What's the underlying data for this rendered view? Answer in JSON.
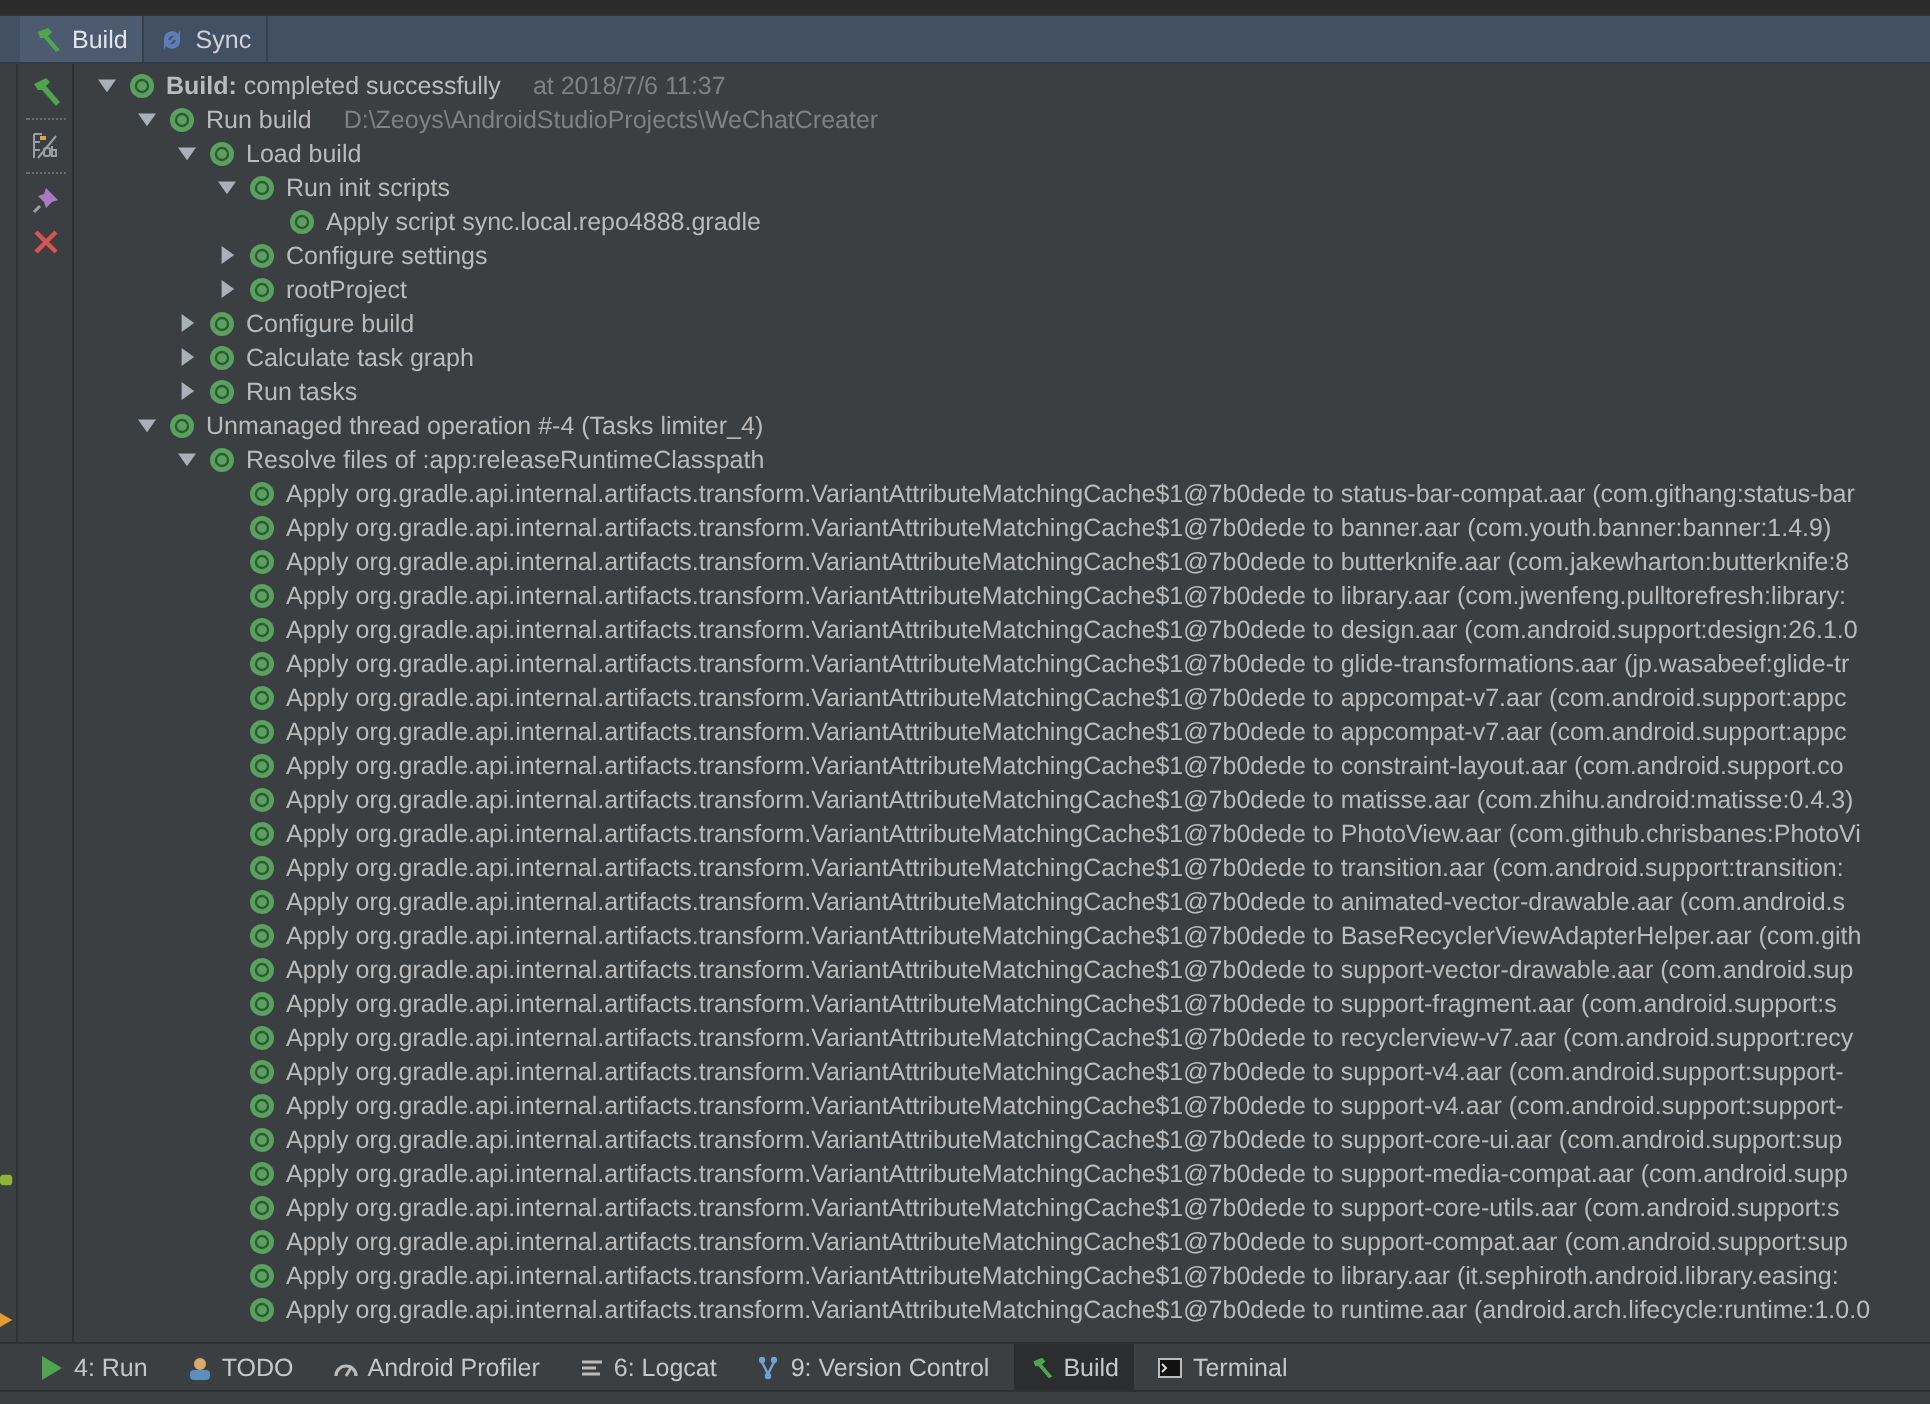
{
  "tabs": [
    {
      "label": "Build",
      "selected": true
    },
    {
      "label": "Sync",
      "selected": false
    }
  ],
  "tree": [
    {
      "label": "**Build:** completed successfully",
      "detail": "at 2018/7/6 11:37",
      "expanded": true,
      "children": [
        {
          "label": "Run build",
          "detail": "D:\\Zeoys\\AndroidStudioProjects\\WeChatCreater",
          "expanded": true,
          "children": [
            {
              "label": "Load build",
              "expanded": true,
              "children": [
                {
                  "label": "Run init scripts",
                  "expanded": true,
                  "children": [
                    {
                      "label": "Apply script sync.local.repo4888.gradle"
                    }
                  ]
                },
                {
                  "label": "Configure settings",
                  "expanded": false
                },
                {
                  "label": "rootProject",
                  "expanded": false
                }
              ]
            },
            {
              "label": "Configure build",
              "expanded": false
            },
            {
              "label": "Calculate task graph",
              "expanded": false
            },
            {
              "label": "Run tasks",
              "expanded": false
            }
          ]
        },
        {
          "label": "Unmanaged thread operation #-4 (Tasks limiter_4)",
          "expanded": true,
          "children": [
            {
              "label": "Resolve files of :app:releaseRuntimeClasspath",
              "expanded": true,
              "children": [
                {
                  "label": "Apply org.gradle.api.internal.artifacts.transform.VariantAttributeMatchingCache$1@7b0dede to status-bar-compat.aar (com.githang:status-bar"
                },
                {
                  "label": "Apply org.gradle.api.internal.artifacts.transform.VariantAttributeMatchingCache$1@7b0dede to banner.aar (com.youth.banner:banner:1.4.9)"
                },
                {
                  "label": "Apply org.gradle.api.internal.artifacts.transform.VariantAttributeMatchingCache$1@7b0dede to butterknife.aar (com.jakewharton:butterknife:8"
                },
                {
                  "label": "Apply org.gradle.api.internal.artifacts.transform.VariantAttributeMatchingCache$1@7b0dede to library.aar (com.jwenfeng.pulltorefresh:library:"
                },
                {
                  "label": "Apply org.gradle.api.internal.artifacts.transform.VariantAttributeMatchingCache$1@7b0dede to design.aar (com.android.support:design:26.1.0"
                },
                {
                  "label": "Apply org.gradle.api.internal.artifacts.transform.VariantAttributeMatchingCache$1@7b0dede to glide-transformations.aar (jp.wasabeef:glide-tr"
                },
                {
                  "label": "Apply org.gradle.api.internal.artifacts.transform.VariantAttributeMatchingCache$1@7b0dede to appcompat-v7.aar (com.android.support:appc"
                },
                {
                  "label": "Apply org.gradle.api.internal.artifacts.transform.VariantAttributeMatchingCache$1@7b0dede to appcompat-v7.aar (com.android.support:appc"
                },
                {
                  "label": "Apply org.gradle.api.internal.artifacts.transform.VariantAttributeMatchingCache$1@7b0dede to constraint-layout.aar (com.android.support.co"
                },
                {
                  "label": "Apply org.gradle.api.internal.artifacts.transform.VariantAttributeMatchingCache$1@7b0dede to matisse.aar (com.zhihu.android:matisse:0.4.3)"
                },
                {
                  "label": "Apply org.gradle.api.internal.artifacts.transform.VariantAttributeMatchingCache$1@7b0dede to PhotoView.aar (com.github.chrisbanes:PhotoVi"
                },
                {
                  "label": "Apply org.gradle.api.internal.artifacts.transform.VariantAttributeMatchingCache$1@7b0dede to transition.aar (com.android.support:transition:"
                },
                {
                  "label": "Apply org.gradle.api.internal.artifacts.transform.VariantAttributeMatchingCache$1@7b0dede to animated-vector-drawable.aar (com.android.s"
                },
                {
                  "label": "Apply org.gradle.api.internal.artifacts.transform.VariantAttributeMatchingCache$1@7b0dede to BaseRecyclerViewAdapterHelper.aar (com.gith"
                },
                {
                  "label": "Apply org.gradle.api.internal.artifacts.transform.VariantAttributeMatchingCache$1@7b0dede to support-vector-drawable.aar (com.android.sup"
                },
                {
                  "label": "Apply org.gradle.api.internal.artifacts.transform.VariantAttributeMatchingCache$1@7b0dede to support-fragment.aar (com.android.support:s"
                },
                {
                  "label": "Apply org.gradle.api.internal.artifacts.transform.VariantAttributeMatchingCache$1@7b0dede to recyclerview-v7.aar (com.android.support:recy"
                },
                {
                  "label": "Apply org.gradle.api.internal.artifacts.transform.VariantAttributeMatchingCache$1@7b0dede to support-v4.aar (com.android.support:support-"
                },
                {
                  "label": "Apply org.gradle.api.internal.artifacts.transform.VariantAttributeMatchingCache$1@7b0dede to support-v4.aar (com.android.support:support-"
                },
                {
                  "label": "Apply org.gradle.api.internal.artifacts.transform.VariantAttributeMatchingCache$1@7b0dede to support-core-ui.aar (com.android.support:sup"
                },
                {
                  "label": "Apply org.gradle.api.internal.artifacts.transform.VariantAttributeMatchingCache$1@7b0dede to support-media-compat.aar (com.android.supp"
                },
                {
                  "label": "Apply org.gradle.api.internal.artifacts.transform.VariantAttributeMatchingCache$1@7b0dede to support-core-utils.aar (com.android.support:s"
                },
                {
                  "label": "Apply org.gradle.api.internal.artifacts.transform.VariantAttributeMatchingCache$1@7b0dede to support-compat.aar (com.android.support:sup"
                },
                {
                  "label": "Apply org.gradle.api.internal.artifacts.transform.VariantAttributeMatchingCache$1@7b0dede to library.aar (it.sephiroth.android.library.easing:"
                },
                {
                  "label": "Apply org.gradle.api.internal.artifacts.transform.VariantAttributeMatchingCache$1@7b0dede to runtime.aar (android.arch.lifecycle:runtime:1.0.0"
                }
              ]
            }
          ]
        }
      ]
    }
  ],
  "tool_windows": [
    {
      "label": "4: Run",
      "selected": false
    },
    {
      "label": "TODO",
      "selected": false
    },
    {
      "label": "Android Profiler",
      "selected": false
    },
    {
      "label": "6: Logcat",
      "selected": false
    },
    {
      "label": "9: Version Control",
      "selected": false
    },
    {
      "label": "Build",
      "selected": true
    },
    {
      "label": "Terminal",
      "selected": false
    }
  ]
}
